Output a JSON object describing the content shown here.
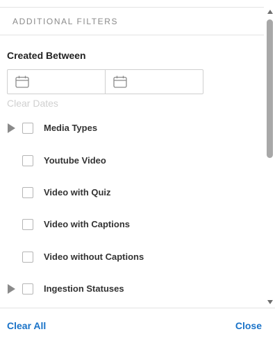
{
  "header": {
    "title": "ADDITIONAL FILTERS"
  },
  "created_between": {
    "label": "Created Between",
    "start_value": "",
    "end_value": "",
    "clear_dates_label": "Clear Dates"
  },
  "filters": [
    {
      "label": "Media Types",
      "expandable": true,
      "checked": false
    },
    {
      "label": "Youtube Video",
      "expandable": false,
      "checked": false
    },
    {
      "label": "Video with Quiz",
      "expandable": false,
      "checked": false
    },
    {
      "label": "Video with Captions",
      "expandable": false,
      "checked": false
    },
    {
      "label": "Video without Captions",
      "expandable": false,
      "checked": false
    },
    {
      "label": "Ingestion Statuses",
      "expandable": true,
      "checked": false
    }
  ],
  "footer": {
    "clear_all_label": "Clear All",
    "close_label": "Close"
  },
  "colors": {
    "link": "#1a73c8",
    "muted_text": "#8a8a8a",
    "disabled_text": "#d0d0d0",
    "border": "#cfcfcf"
  },
  "icons": {
    "date_picker": "calendar-icon",
    "expand": "caret-right-icon"
  }
}
